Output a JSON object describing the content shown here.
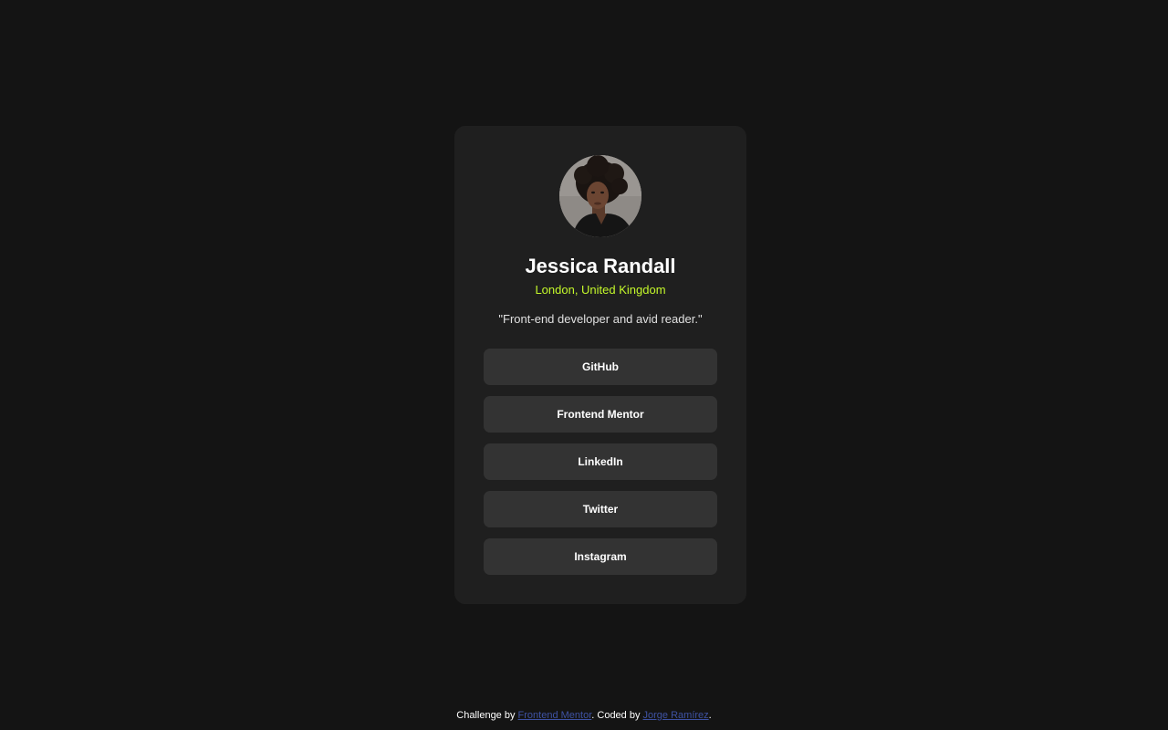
{
  "profile": {
    "name": "Jessica Randall",
    "location": "London, United Kingdom",
    "bio": "\"Front-end developer and avid reader.\"",
    "avatar_icon": "avatar-photo"
  },
  "links": [
    {
      "label": "GitHub"
    },
    {
      "label": "Frontend Mentor"
    },
    {
      "label": "LinkedIn"
    },
    {
      "label": "Twitter"
    },
    {
      "label": "Instagram"
    }
  ],
  "footer": {
    "prefix": "Challenge by ",
    "challenge_link": "Frontend Mentor",
    "middle": ". Coded by ",
    "author_link": "Jorge Ramírez",
    "suffix": "."
  },
  "colors": {
    "background": "#141414",
    "card": "#1f1f1f",
    "button": "#333333",
    "accent": "#c4f82a",
    "link": "#3e52a3"
  }
}
